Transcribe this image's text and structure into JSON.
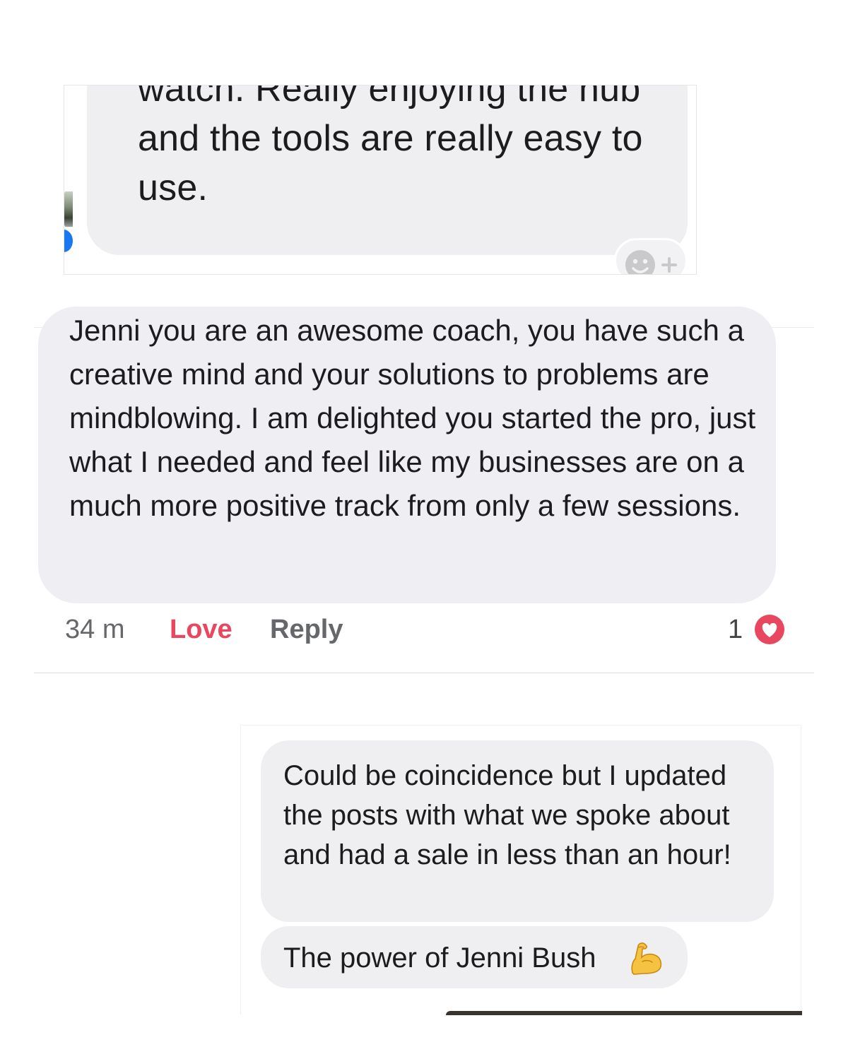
{
  "shot1": {
    "message": "watch. Really enjoying the hub and the tools are really easy to use."
  },
  "shot2": {
    "message": "Jenni you are an awesome coach, you have such a creative mind and your solutions to problems are mindblowing. I am delighted you started the pro, just what I needed and feel like my businesses are on a much more positive track from only a few sessions.",
    "time": "34 m",
    "love_label": "Love",
    "reply_label": "Reply",
    "reaction_count": "1",
    "love_color": "#e8475f"
  },
  "shot3": {
    "message_1": "Could be coincidence but I updated the posts with what we spoke about and had a sale in less than an hour!",
    "message_2": "The power of Jenni Bush",
    "emoji": "flexed-biceps-icon"
  }
}
